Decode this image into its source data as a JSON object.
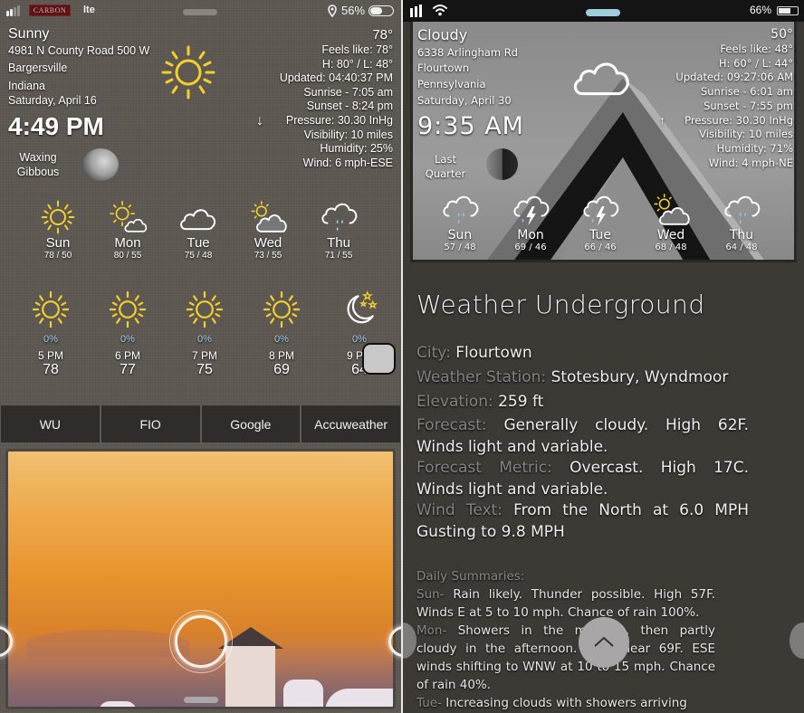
{
  "left_screen": {
    "status_bar": {
      "carrier": "CARBON",
      "network": "lte",
      "battery_percent_label": "56%",
      "battery_level": 0.56,
      "icons": [
        "signal-icon",
        "location-icon",
        "battery-icon"
      ]
    },
    "current": {
      "condition": "Sunny",
      "address_line1": "4981 N County Road 500 W",
      "city": "Bargersville",
      "state": "Indiana",
      "date": "Saturday, April 16",
      "time": "4:49 PM",
      "moon_phase_line1": "Waxing",
      "moon_phase_line2": "Gibbous",
      "icon": "sun-icon",
      "pressure_trend": "↓",
      "temperature": "78°",
      "details": [
        "Feels like: 78°",
        "H: 80° / L: 48°",
        "Updated: 04:40:37 PM",
        "Sunrise - 7:05 am",
        "Sunset - 8:24 pm",
        "Pressure: 30.30 InHg",
        "Visibility: 10 miles",
        "Humidity: 25%",
        "Wind: 6 mph-ESE"
      ]
    },
    "daily": [
      {
        "day": "Sun",
        "range": "78 / 50",
        "icon": "sun-icon"
      },
      {
        "day": "Mon",
        "range": "80 / 55",
        "icon": "partly-cloudy-icon"
      },
      {
        "day": "Tue",
        "range": "75 / 48",
        "icon": "cloud-icon"
      },
      {
        "day": "Wed",
        "range": "73 / 55",
        "icon": "mostly-cloudy-icon"
      },
      {
        "day": "Thu",
        "range": "71 / 55",
        "icon": "rain-icon"
      }
    ],
    "hourly": [
      {
        "time": "5 PM",
        "temp": "78",
        "pop": "0%",
        "icon": "sun-icon"
      },
      {
        "time": "6 PM",
        "temp": "77",
        "pop": "0%",
        "icon": "sun-icon"
      },
      {
        "time": "7 PM",
        "temp": "75",
        "pop": "0%",
        "icon": "sun-icon"
      },
      {
        "time": "8 PM",
        "temp": "69",
        "pop": "0%",
        "icon": "sun-icon"
      },
      {
        "time": "9 PM",
        "temp": "64",
        "pop": "0%",
        "icon": "moon-stars-icon"
      }
    ],
    "tabs": [
      "WU",
      "FIO",
      "Google",
      "Accuweather"
    ]
  },
  "right_screen": {
    "status_bar": {
      "battery_percent_label": "66%",
      "battery_level": 0.66,
      "icons": [
        "signal-icon",
        "wifi-icon",
        "battery-icon"
      ]
    },
    "current": {
      "condition": "Cloudy",
      "address_line1": "6338 Arlingham Rd",
      "city": "Flourtown",
      "state": "Pennsylvania",
      "date": "Saturday, April 30",
      "time": "9:35 AM",
      "moon_phase_line1": "Last",
      "moon_phase_line2": "Quarter",
      "icon": "cloud-icon",
      "pressure_trend": "↑",
      "temperature": "50°",
      "details": [
        "Feels like: 48°",
        "H: 60° / L: 44°",
        "Updated: 09:27:06 AM",
        "Sunrise - 6:01 am",
        "Sunset - 7:55 pm",
        "Pressure: 30.30 InHg",
        "Visibility: 10 miles",
        "Humidity: 71%",
        "Wind: 4 mph-NE"
      ]
    },
    "daily": [
      {
        "day": "Sun",
        "range": "57 / 48",
        "icon": "rain-icon"
      },
      {
        "day": "Mon",
        "range": "69 / 46",
        "icon": "thunderstorm-icon"
      },
      {
        "day": "Tue",
        "range": "66 / 46",
        "icon": "thunderstorm-icon"
      },
      {
        "day": "Wed",
        "range": "68 / 48",
        "icon": "mostly-cloudy-icon"
      },
      {
        "day": "Thu",
        "range": "64 / 48",
        "icon": "rain-icon"
      }
    ],
    "provider_title": "Weather Underground",
    "info": {
      "city_label": "City:",
      "city_value": "Flourtown",
      "station_label": "Weather Station:",
      "station_value": "Stotesbury, Wyndmoor",
      "elevation_label": "Elevation:",
      "elevation_value": "259 ft",
      "forecast_label": "Forecast:",
      "forecast_value": "Generally cloudy. High 62F. Winds light and variable.",
      "forecast_metric_label": "Forecast Metric:",
      "forecast_metric_value": "Overcast. High 17C. Winds light and variable.",
      "wind_text_label": "Wind Text:",
      "wind_text_value": "From the North at 6.0 MPH Gusting to 9.8 MPH"
    },
    "daily_summaries": {
      "heading": "Daily Summaries:",
      "items": [
        {
          "label": "Sun-",
          "text": " Rain likely. Thunder possible. High 57F. Winds E at 5 to 10 mph. Chance of rain 100%."
        },
        {
          "label": "Mon-",
          "text": " Showers in the morning, then partly cloudy in the afternoon. High near 69F. ESE winds shifting to WNW at 10 to 15 mph. Chance of rain 40%."
        },
        {
          "label": "Tue-",
          "text": " Increasing clouds with showers arriving"
        }
      ]
    }
  },
  "colors": {
    "sun_yellow": "#f3cf2a",
    "rain_blue": "#8cc4ea",
    "pop_blue": "#a9d2ea",
    "label_gray": "#858280"
  }
}
